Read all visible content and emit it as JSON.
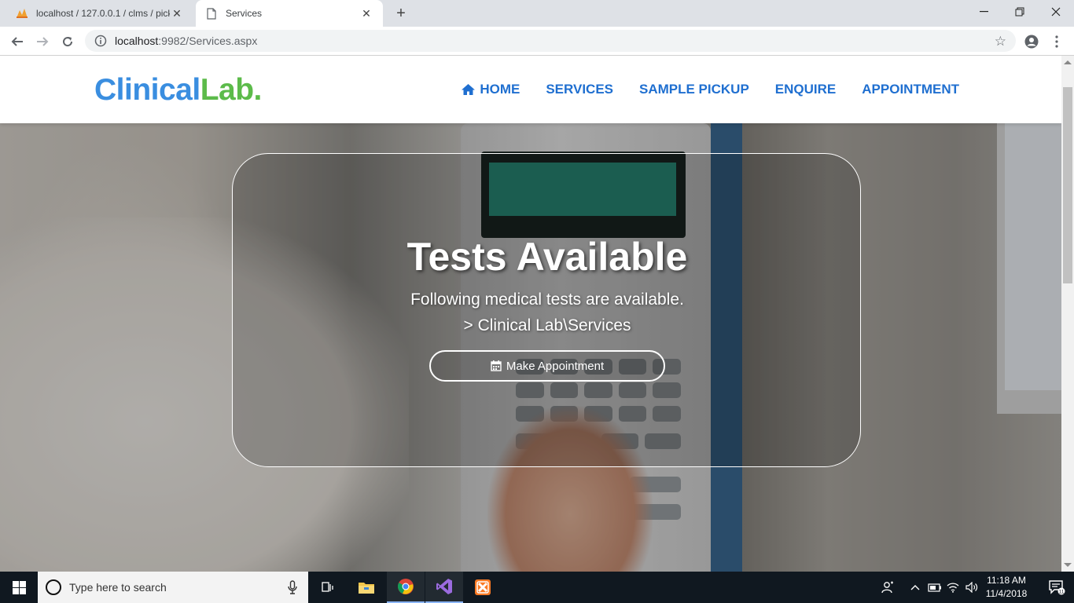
{
  "browser": {
    "tabs": [
      {
        "title": "localhost / 127.0.0.1 / clms / pick",
        "favicon": "phpmyadmin-icon"
      },
      {
        "title": "Services",
        "favicon": "page-icon"
      }
    ],
    "url_host": "localhost",
    "url_rest": ":9982/Services.aspx"
  },
  "site": {
    "logo_part1": "Clinical",
    "logo_part2": "Lab.",
    "nav": [
      {
        "label": "HOME",
        "icon": "home-icon"
      },
      {
        "label": "SERVICES"
      },
      {
        "label": "SAMPLE PICKUP"
      },
      {
        "label": "ENQUIRE"
      },
      {
        "label": "APPOINTMENT"
      }
    ]
  },
  "hero": {
    "title": "Tests Available",
    "subtitle": "Following medical tests are available.",
    "breadcrumb": "> Clinical Lab\\Services",
    "button_label": "Make Appointment",
    "button_icon": "calendar-icon"
  },
  "taskbar": {
    "search_placeholder": "Type here to search",
    "time": "11:18 AM",
    "date": "11/4/2018",
    "notification_count": "11"
  },
  "colors": {
    "logo_blue": "#3a8ee0",
    "logo_green": "#5cbb4a",
    "nav_blue": "#1f6fd0"
  }
}
